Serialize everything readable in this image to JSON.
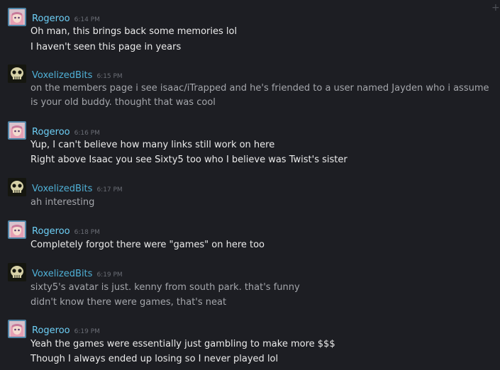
{
  "messages": [
    {
      "user": "Rogeroo",
      "time": "6:14 PM",
      "lines": [
        "Oh man, this brings back some memories lol",
        "I haven't seen this page in years"
      ]
    },
    {
      "user": "VoxelizedBits",
      "time": "6:15 PM",
      "lines": [
        "on the members page i see isaac/iTrapped and he's friended to a user named Jayden who i assume",
        "is your old buddy. thought that was cool"
      ]
    },
    {
      "user": "Rogeroo",
      "time": "6:16 PM",
      "lines": [
        "Yup, I can't believe how many links still work on here",
        "Right above Isaac you see Sixty5 too who I believe was Twist's sister"
      ]
    },
    {
      "user": "VoxelizedBits",
      "time": "6:17 PM",
      "lines": [
        "ah interesting"
      ]
    },
    {
      "user": "Rogeroo",
      "time": "6:18 PM",
      "lines": [
        "Completely forgot there were \"games\" on here too"
      ]
    },
    {
      "user": "VoxelizedBits",
      "time": "6:19 PM",
      "lines": [
        "sixty5's avatar is just. kenny from south park. that's funny",
        "didn't know there were games, that's neat"
      ]
    },
    {
      "user": "Rogeroo",
      "time": "6:19 PM",
      "lines": [
        "Yeah the games were essentially just gambling to make more $$$",
        "Though I always ended up losing so I never played lol"
      ]
    }
  ],
  "icons": {
    "corner": "plus-icon",
    "rogeroo_avatar": "anime-avatar",
    "voxelized_avatar": "skull-avatar"
  },
  "colors": {
    "background": "#1d1e23",
    "username_rogeroo": "#6dcff6",
    "username_voxelized": "#4fb0d6",
    "text_rogeroo": "#ebebeb",
    "text_voxelized": "#a4a6ab",
    "timestamp": "#6a6d75"
  }
}
